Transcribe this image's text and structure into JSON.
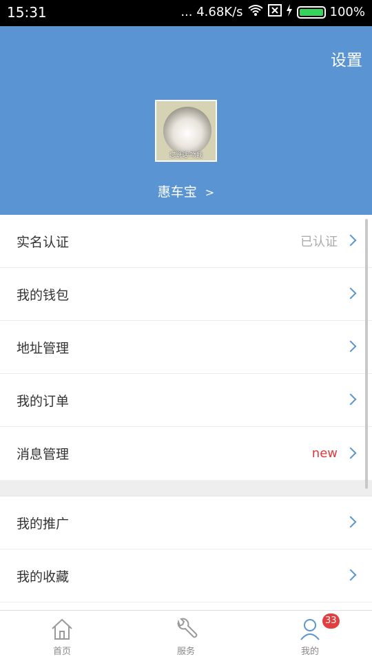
{
  "status_bar": {
    "time": "15:31",
    "network_speed": "... 4.68K/s",
    "battery": "100%"
  },
  "header": {
    "settings_label": "设置",
    "avatar_caption": "您说话 吻我",
    "username": "惠车宝",
    "username_chevron": ">"
  },
  "menu_group1": [
    {
      "label": "实名认证",
      "status": "已认证"
    },
    {
      "label": "我的钱包",
      "status": ""
    },
    {
      "label": "地址管理",
      "status": ""
    },
    {
      "label": "我的订单",
      "status": ""
    },
    {
      "label": "消息管理",
      "status": "new"
    }
  ],
  "menu_group2": [
    {
      "label": "我的推广",
      "status": ""
    },
    {
      "label": "我的收藏",
      "status": ""
    }
  ],
  "tabbar": {
    "tabs": [
      {
        "label": "首页",
        "icon": "home-icon"
      },
      {
        "label": "服务",
        "icon": "wrench-icon"
      },
      {
        "label": "我的",
        "icon": "person-icon"
      }
    ],
    "badge_count": "33"
  },
  "colors": {
    "header_bg": "#5b94d3",
    "accent": "#5b94d3",
    "new_red": "#e23a3a"
  }
}
